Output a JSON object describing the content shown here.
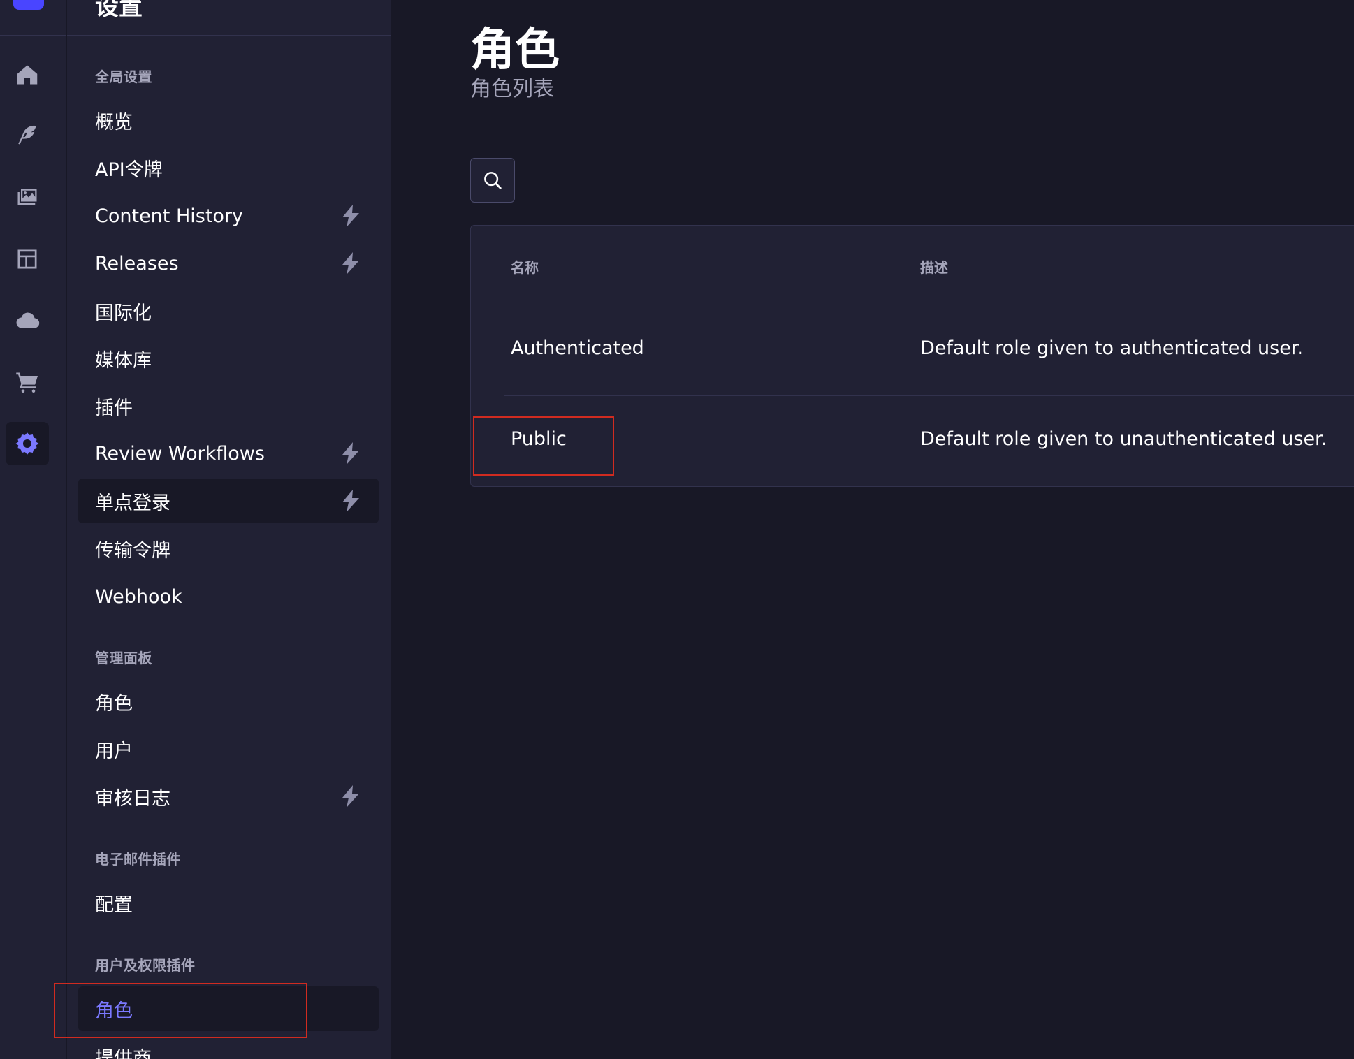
{
  "sidebar_rail": {
    "items": [
      {
        "icon": "home-icon"
      },
      {
        "icon": "feather-icon"
      },
      {
        "icon": "media-icon"
      },
      {
        "icon": "layout-icon"
      },
      {
        "icon": "cloud-icon"
      },
      {
        "icon": "cart-icon"
      },
      {
        "icon": "settings-icon",
        "active": true
      }
    ]
  },
  "subnav": {
    "title": "设置",
    "sections": [
      {
        "label": "全局设置",
        "items": [
          {
            "label": "概览"
          },
          {
            "label": "API令牌"
          },
          {
            "label": "Content History",
            "bolt": true
          },
          {
            "label": "Releases",
            "bolt": true
          },
          {
            "label": "国际化"
          },
          {
            "label": "媒体库"
          },
          {
            "label": "插件"
          },
          {
            "label": "Review Workflows",
            "bolt": true
          },
          {
            "label": "单点登录",
            "bolt": true
          },
          {
            "label": "传输令牌"
          },
          {
            "label": "Webhook"
          }
        ]
      },
      {
        "label": "管理面板",
        "items": [
          {
            "label": "角色"
          },
          {
            "label": "用户"
          },
          {
            "label": "审核日志",
            "bolt": true
          }
        ]
      },
      {
        "label": "电子邮件插件",
        "items": [
          {
            "label": "配置"
          }
        ]
      },
      {
        "label": "用户及权限插件",
        "items": [
          {
            "label": "角色",
            "current": true
          },
          {
            "label": "提供商"
          }
        ]
      }
    ]
  },
  "main": {
    "title": "角色",
    "subtitle": "角色列表",
    "table": {
      "headers": [
        "名称",
        "描述"
      ],
      "rows": [
        {
          "name": "Authenticated",
          "description": "Default role given to authenticated user."
        },
        {
          "name": "Public",
          "description": "Default role given to unauthenticated user."
        }
      ]
    }
  },
  "colors": {
    "background": "#181826",
    "panel": "#212134",
    "accent": "#7b79ff",
    "brand": "#4945ff",
    "highlight_box": "#d02b20"
  }
}
